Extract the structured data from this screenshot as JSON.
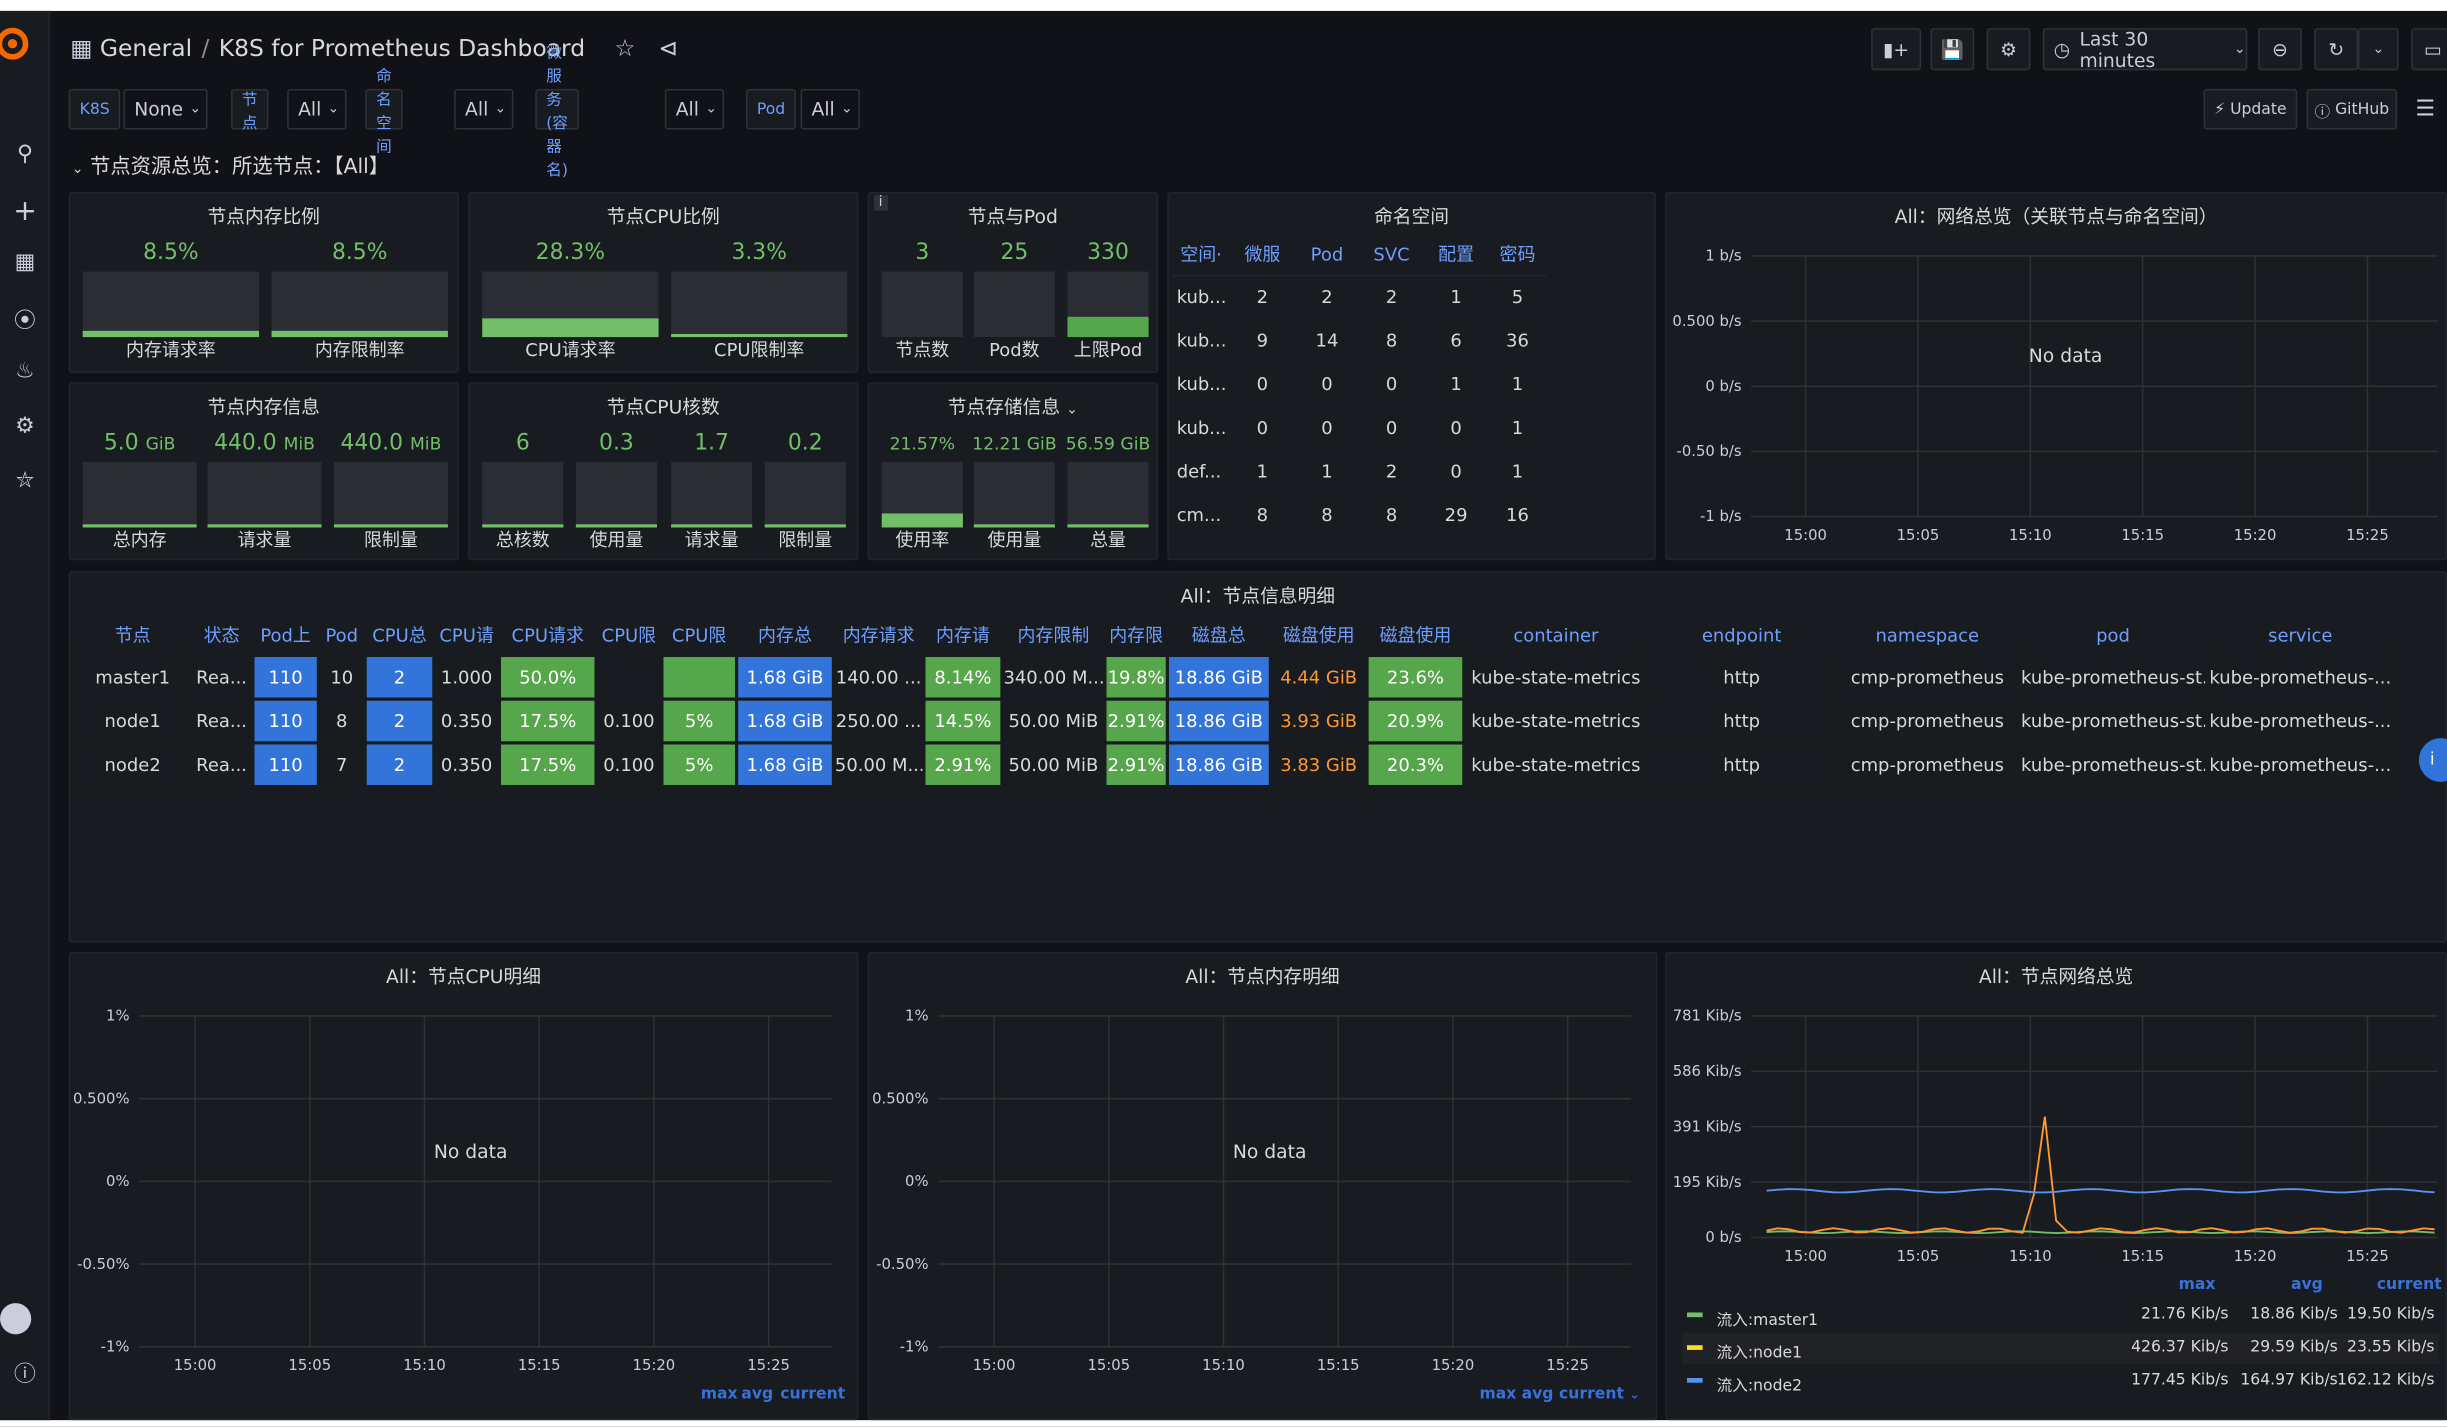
{
  "header": {
    "crumb_root": "General",
    "crumb_sep": "/",
    "title": "K8S for Prometheus Dashboard",
    "time_range": "Last 30 minutes",
    "update_label": "Update",
    "github_label": "GitHub"
  },
  "variables": [
    {
      "label": "K8S",
      "value": "None"
    },
    {
      "label": "节点",
      "value": "All"
    },
    {
      "label": "命名空间",
      "value": "All"
    },
    {
      "label": "微服务(容器名)",
      "value": "All"
    },
    {
      "label": "Pod",
      "value": "All"
    }
  ],
  "row_title": "节点资源总览：所选节点：【All】",
  "mem_ratio": {
    "title": "节点内存比例",
    "items": [
      {
        "value": "8.5%",
        "label": "内存请求率",
        "fill": 0.085
      },
      {
        "value": "8.5%",
        "label": "内存限制率",
        "fill": 0.085
      }
    ]
  },
  "cpu_ratio": {
    "title": "节点CPU比例",
    "items": [
      {
        "value": "28.3%",
        "label": "CPU请求率",
        "fill": 0.283
      },
      {
        "value": "3.3%",
        "label": "CPU限制率",
        "fill": 0.033
      }
    ]
  },
  "node_pod": {
    "title": "节点与Pod",
    "items": [
      {
        "value": "3",
        "label": "节点数",
        "fill": 0.0
      },
      {
        "value": "25",
        "label": "Pod数",
        "fill": 0.0
      },
      {
        "value": "330",
        "label": "上限Pod",
        "fill": 0.3
      }
    ]
  },
  "mem_info": {
    "title": "节点内存信息",
    "items": [
      {
        "value": "5.0",
        "unit": "GiB",
        "label": "总内存"
      },
      {
        "value": "440.0",
        "unit": "MiB",
        "label": "请求量"
      },
      {
        "value": "440.0",
        "unit": "MiB",
        "label": "限制量"
      }
    ]
  },
  "cpu_cores": {
    "title": "节点CPU核数",
    "items": [
      {
        "value": "6",
        "label": "总核数"
      },
      {
        "value": "0.3",
        "label": "使用量"
      },
      {
        "value": "1.7",
        "label": "请求量"
      },
      {
        "value": "0.2",
        "label": "限制量"
      }
    ]
  },
  "storage": {
    "title": "节点存储信息",
    "items": [
      {
        "value": "21.57%",
        "label": "使用率",
        "fill": 0.2157
      },
      {
        "value": "12.21 GiB",
        "label": "使用量",
        "fill": 0.0
      },
      {
        "value": "56.59 GiB",
        "label": "总量",
        "fill": 0.0
      }
    ]
  },
  "namespaces": {
    "title": "命名空间",
    "headers": [
      "空间·",
      "微服",
      "Pod",
      "SVC",
      "配置",
      "密码"
    ],
    "rows": [
      [
        "kub...",
        "2",
        "2",
        "2",
        "1",
        "5"
      ],
      [
        "kub...",
        "9",
        "14",
        "8",
        "6",
        "36"
      ],
      [
        "kub...",
        "0",
        "0",
        "0",
        "1",
        "1"
      ],
      [
        "kub...",
        "0",
        "0",
        "0",
        "0",
        "1"
      ],
      [
        "def...",
        "1",
        "1",
        "2",
        "0",
        "1"
      ],
      [
        "cm...",
        "8",
        "8",
        "8",
        "29",
        "16"
      ]
    ]
  },
  "net_overview": {
    "title": "All：网络总览（关联节点与命名空间）",
    "nodata": "No data",
    "yticks": [
      "1 b/s",
      "0.500 b/s",
      "0 b/s",
      "-0.50 b/s",
      "-1 b/s"
    ],
    "xticks": [
      "15:00",
      "15:05",
      "15:10",
      "15:15",
      "15:20",
      "15:25"
    ]
  },
  "node_table": {
    "title": "All：节点信息明细",
    "headers": [
      "节点",
      "状态",
      "Pod上",
      "Pod",
      "CPU总",
      "CPU请",
      "CPU请求",
      "CPU限",
      "CPU限",
      "内存总",
      "内存请求",
      "内存请",
      "内存限制",
      "内存限",
      "磁盘总",
      "磁盘使用",
      "磁盘使用",
      "container",
      "endpoint",
      "namespace",
      "pod",
      "service"
    ],
    "rows": [
      [
        "master1",
        "Rea...",
        "110",
        "10",
        "2",
        "1.000",
        "50.0%",
        "",
        "",
        "1.68 GiB",
        "140.00 ...",
        "8.14%",
        "340.00 M...",
        "19.8%",
        "18.86 GiB",
        "4.44 GiB",
        "23.6%",
        "kube-state-metrics",
        "http",
        "cmp-prometheus",
        "kube-prometheus-st...",
        "kube-prometheus-..."
      ],
      [
        "node1",
        "Rea...",
        "110",
        "8",
        "2",
        "0.350",
        "17.5%",
        "0.100",
        "5%",
        "1.68 GiB",
        "250.00 ...",
        "14.5%",
        "50.00 MiB",
        "2.91%",
        "18.86 GiB",
        "3.93 GiB",
        "20.9%",
        "kube-state-metrics",
        "http",
        "cmp-prometheus",
        "kube-prometheus-st...",
        "kube-prometheus-..."
      ],
      [
        "node2",
        "Rea...",
        "110",
        "7",
        "2",
        "0.350",
        "17.5%",
        "0.100",
        "5%",
        "1.68 GiB",
        "50.00 M...",
        "2.91%",
        "50.00 MiB",
        "2.91%",
        "18.86 GiB",
        "3.83 GiB",
        "20.3%",
        "kube-state-metrics",
        "http",
        "cmp-prometheus",
        "kube-prometheus-st...",
        "kube-prometheus-..."
      ]
    ]
  },
  "cpu_detail": {
    "title": "All：节点CPU明细",
    "nodata": "No data",
    "yticks": [
      "1%",
      "0.500%",
      "0%",
      "-0.50%",
      "-1%"
    ],
    "xticks": [
      "15:00",
      "15:05",
      "15:10",
      "15:15",
      "15:20",
      "15:25"
    ],
    "legend_max": "max",
    "legend_avg": "avg",
    "legend_cur": "current"
  },
  "mem_detail": {
    "title": "All：节点内存明细",
    "nodata": "No data",
    "yticks": [
      "1%",
      "0.500%",
      "0%",
      "-0.50%",
      "-1%"
    ],
    "xticks": [
      "15:00",
      "15:05",
      "15:10",
      "15:15",
      "15:20",
      "15:25"
    ],
    "legend_max": "max",
    "legend_avg": "avg",
    "legend_cur": "current"
  },
  "net_detail": {
    "title": "All：节点网络总览",
    "yticks": [
      "781 Kib/s",
      "586 Kib/s",
      "391 Kib/s",
      "195 Kib/s",
      "0 b/s"
    ],
    "xticks": [
      "15:00",
      "15:05",
      "15:10",
      "15:15",
      "15:20",
      "15:25"
    ],
    "legend_max": "max",
    "legend_avg": "avg",
    "legend_cur": "current",
    "legend": [
      {
        "name": "流入:master1",
        "max": "21.76 Kib/s",
        "avg": "18.86 Kib/s",
        "current": "19.50 Kib/s",
        "color": "#73bf69"
      },
      {
        "name": "流入:node1",
        "max": "426.37 Kib/s",
        "avg": "29.59 Kib/s",
        "current": "23.55 Kib/s",
        "color": "#fade2a"
      },
      {
        "name": "流入:node2",
        "max": "177.45 Kib/s",
        "avg": "164.97 Kib/s",
        "current": "162.12 Kib/s",
        "color": "#5794f2"
      }
    ]
  },
  "chart_data": {
    "type": "line",
    "title": "All：节点网络总览",
    "x": [
      "15:00",
      "15:05",
      "15:10",
      "15:15",
      "15:20",
      "15:25"
    ],
    "ylim": [
      0,
      781
    ],
    "ylabel": "Kib/s",
    "series": [
      {
        "name": "流入:master1",
        "values": [
          19,
          20,
          18,
          21,
          19,
          19.5
        ],
        "color": "#73bf69"
      },
      {
        "name": "流入:node1",
        "values": [
          25,
          30,
          426,
          28,
          25,
          23.5
        ],
        "color": "#ff9830"
      },
      {
        "name": "流入:node2",
        "values": [
          165,
          160,
          170,
          162,
          166,
          162
        ],
        "color": "#5794f2"
      }
    ]
  }
}
